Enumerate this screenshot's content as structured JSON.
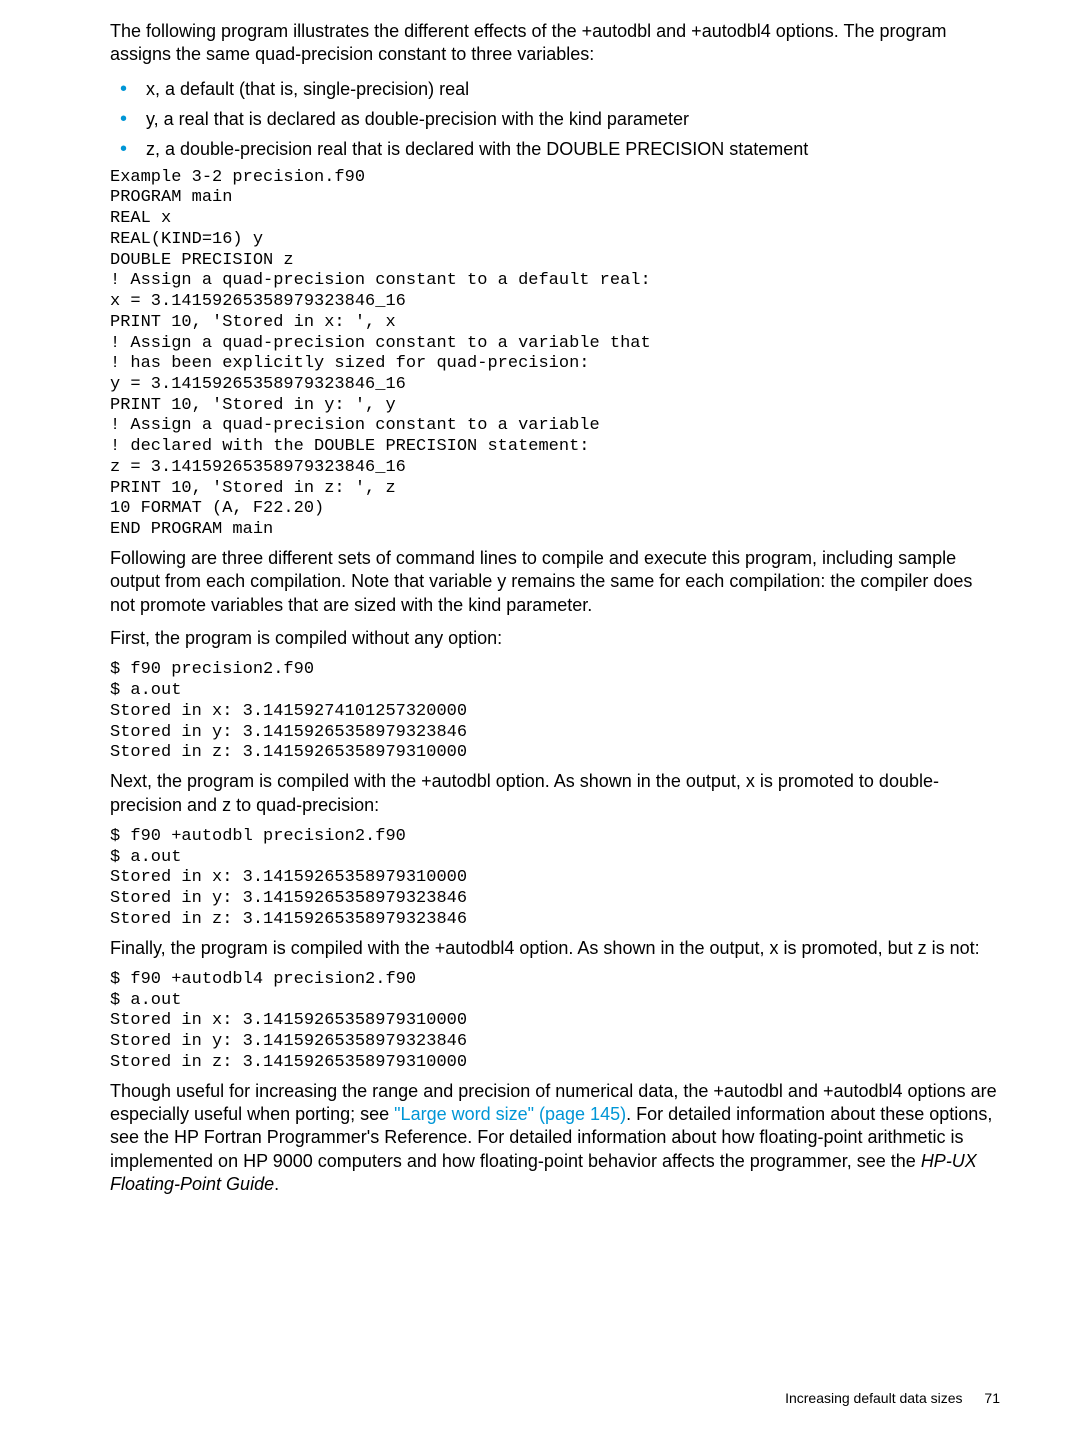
{
  "intro": "The following program illustrates the different effects of the +autodbl and +autodbl4 options. The program assigns the same quad-precision constant to three variables:",
  "bullets": [
    "x, a default (that is, single-precision) real",
    "y, a real that is declared as double-precision with the kind parameter",
    "z, a double-precision real that is declared with the DOUBLE PRECISION statement"
  ],
  "code1": "Example 3-2 precision.f90\nPROGRAM main\nREAL x\nREAL(KIND=16) y\nDOUBLE PRECISION z\n! Assign a quad-precision constant to a default real:\nx = 3.14159265358979323846_16\nPRINT 10, 'Stored in x: ', x\n! Assign a quad-precision constant to a variable that\n! has been explicitly sized for quad-precision:\ny = 3.14159265358979323846_16\nPRINT 10, 'Stored in y: ', y\n! Assign a quad-precision constant to a variable\n! declared with the DOUBLE PRECISION statement:\nz = 3.14159265358979323846_16\nPRINT 10, 'Stored in z: ', z\n10 FORMAT (A, F22.20)\nEND PROGRAM main",
  "para2": "Following are three different sets of command lines to compile and execute this program, including sample output from each compilation. Note that variable y remains the same for each compilation: the compiler does not promote variables that are sized with the kind parameter.",
  "para3": "First, the program is compiled without any option:",
  "code2": "$ f90 precision2.f90\n$ a.out\nStored in x: 3.14159274101257320000\nStored in y: 3.14159265358979323846\nStored in z: 3.14159265358979310000",
  "para4": "Next, the program is compiled with the +autodbl option. As shown in the output, x is promoted to double-precision and z to quad-precision:",
  "code3": "$ f90 +autodbl precision2.f90\n$ a.out\nStored in x: 3.14159265358979310000\nStored in y: 3.14159265358979323846\nStored in z: 3.14159265358979323846",
  "para5": "Finally, the program is compiled with the +autodbl4 option. As shown in the output, x is promoted, but z is not:",
  "code4": "$ f90 +autodbl4 precision2.f90\n$ a.out\nStored in x: 3.14159265358979310000\nStored in y: 3.14159265358979323846\nStored in z: 3.14159265358979310000",
  "para6a": "Though useful for increasing the range and precision of numerical data, the +autodbl and +autodbl4 options are especially useful when porting; see ",
  "link_text": "\"Large word size\" (page 145)",
  "para6b": ". For detailed information about these options, see the HP Fortran Programmer's Reference. For detailed information about how floating-point arithmetic is implemented on HP 9000 computers and how floating-point behavior affects the programmer, see the ",
  "guide_title": "HP-UX Floating-Point Guide",
  "para6c": ".",
  "footer_label": "Increasing default data sizes",
  "footer_page": "71"
}
